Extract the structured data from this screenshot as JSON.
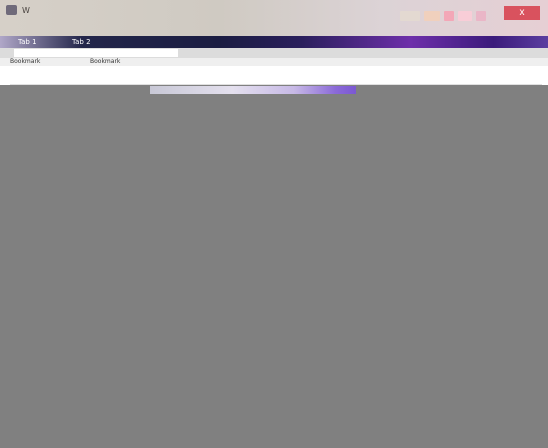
{
  "window": {
    "title": "W",
    "close_label": "x"
  },
  "tabs": [
    {
      "label": "Tab 1"
    },
    {
      "label": "Tab 2"
    }
  ],
  "address": {
    "value": ""
  },
  "bookmarks": [
    {
      "label": "Bookmark"
    },
    {
      "label": "Bookmark"
    }
  ],
  "content": {
    "header_label": "",
    "canvas_heading": "",
    "loading_text": "",
    "progress_fraction": 0.0
  }
}
